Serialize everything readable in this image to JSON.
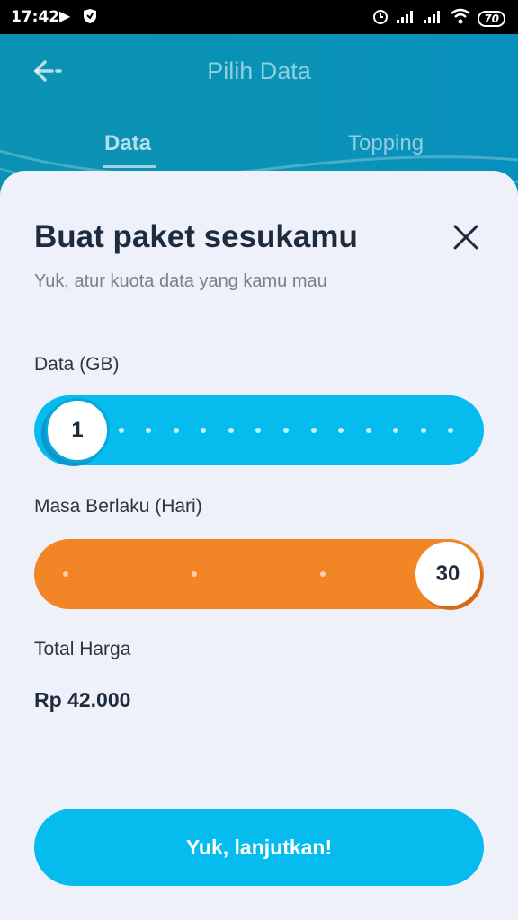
{
  "status_bar": {
    "time": "17:42",
    "battery": "70"
  },
  "header": {
    "title": "Pilih Data",
    "tabs": [
      {
        "label": "Data"
      },
      {
        "label": "Topping"
      }
    ]
  },
  "sheet": {
    "title": "Buat paket sesukamu",
    "subtitle": "Yuk, atur kuota data yang kamu mau",
    "data_slider": {
      "label": "Data (GB)",
      "value": "1"
    },
    "masa_slider": {
      "label": "Masa Berlaku (Hari)",
      "value": "30"
    },
    "total": {
      "label": "Total Harga",
      "price": "Rp 42.000"
    },
    "cta_label": "Yuk, lanjutkan!"
  },
  "colors": {
    "accent_blue": "#06bcee",
    "accent_orange": "#f28526",
    "header_teal": "#0a91b5"
  },
  "icons": [
    "back-arrow-icon",
    "close-icon",
    "play-icon",
    "shield-icon",
    "alarm-icon",
    "signal-icon",
    "wifi-icon",
    "battery-icon"
  ]
}
